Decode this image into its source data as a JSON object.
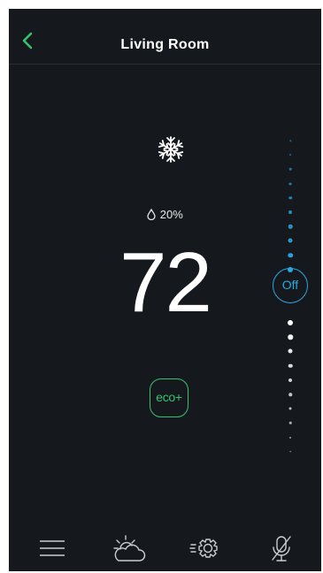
{
  "header": {
    "title": "Living Room",
    "back_icon": "chevron-left-icon"
  },
  "status": {
    "mode_icon": "snowflake-icon",
    "humidity": "20%"
  },
  "temperature": {
    "value": "72"
  },
  "eco": {
    "label": "eco+"
  },
  "setpoint_slider": {
    "off_label": "Off",
    "cool_steps": 10,
    "heat_steps": 10,
    "current": "off"
  },
  "bottom_nav": [
    {
      "name": "menu-icon"
    },
    {
      "name": "weather-icon"
    },
    {
      "name": "settings-icon"
    },
    {
      "name": "mic-off-icon"
    }
  ],
  "colors": {
    "accent_green": "#37c26e",
    "cool_blue": "#2aa8e0",
    "background": "#15191e"
  }
}
